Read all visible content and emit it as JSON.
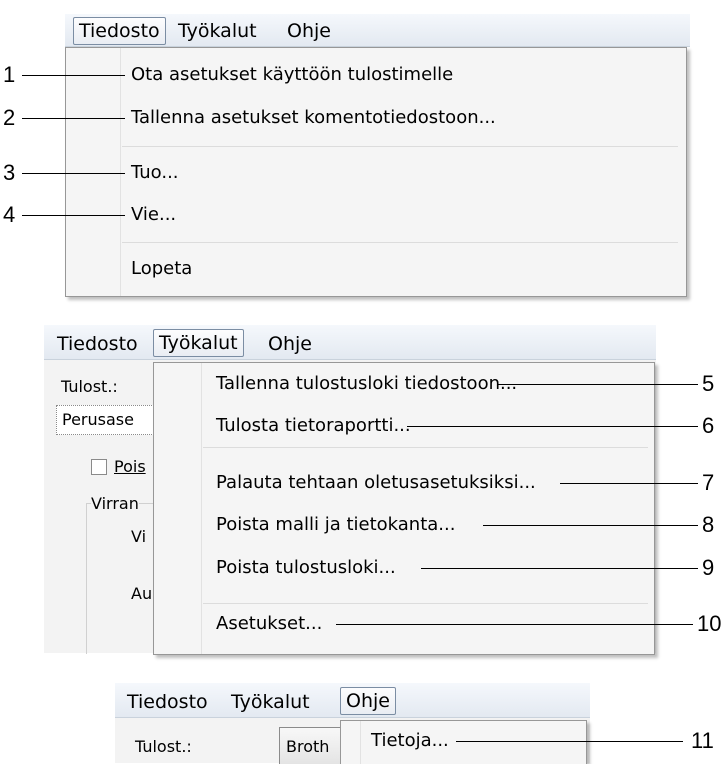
{
  "panel1": {
    "menubar": {
      "file": "Tiedosto",
      "tools": "Työkalut",
      "help": "Ohje"
    },
    "items": [
      "Ota asetukset käyttöön tulostimelle",
      "Tallenna asetukset komentotiedostoon...",
      "Tuo...",
      "Vie...",
      "Lopeta"
    ],
    "callouts": [
      "1",
      "2",
      "3",
      "4"
    ]
  },
  "panel2": {
    "menubar": {
      "file": "Tiedosto",
      "tools": "Työkalut",
      "help": "Ohje"
    },
    "background": {
      "printer_label": "Tulost.:",
      "tab_label": "Perusase",
      "checkbox_label": "Pois",
      "group_label": "Virran",
      "field1": "Vi",
      "field2": "Au"
    },
    "items": [
      "Tallenna tulostusloki tiedostoon...",
      "Tulosta tietoraportti...",
      "Palauta tehtaan oletusasetuksiksi...",
      "Poista malli ja tietokanta...",
      "Poista tulostusloki...",
      "Asetukset..."
    ],
    "callouts": [
      "5",
      "6",
      "7",
      "8",
      "9",
      "10"
    ]
  },
  "panel3": {
    "menubar": {
      "file": "Tiedosto",
      "tools": "Työkalut",
      "help": "Ohje"
    },
    "background": {
      "printer_label": "Tulost.:",
      "printer_value": "Broth"
    },
    "items": [
      "Tietoja..."
    ],
    "callouts": [
      "11"
    ]
  },
  "colors": {
    "menu_bg": "#f5f5f5",
    "menubar_bg": "#e3e9f1",
    "border": "#979797"
  }
}
